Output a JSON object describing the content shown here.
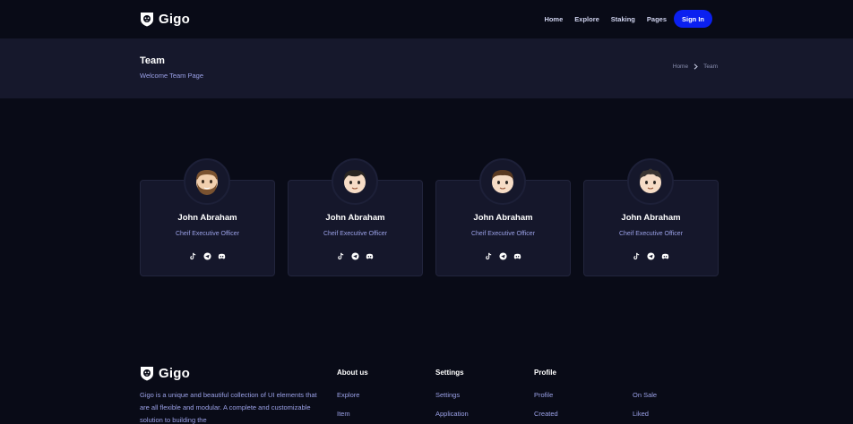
{
  "brand": {
    "name": "Gigo",
    "logo_icon": "lion-shield-icon"
  },
  "nav": {
    "items": [
      {
        "label": "Home"
      },
      {
        "label": "Explore"
      },
      {
        "label": "Staking"
      },
      {
        "label": "Pages"
      }
    ],
    "signin_label": "Sign In"
  },
  "banner": {
    "title": "Team",
    "subtitle": "Welcome Team Page",
    "breadcrumb": [
      "Home",
      "Team"
    ]
  },
  "team": {
    "members": [
      {
        "name": "John Abraham",
        "role": "Cheif Executive Officer",
        "avatar": "bearded-man-emoji",
        "socials": [
          "tiktok-icon",
          "telegram-icon",
          "discord-icon"
        ]
      },
      {
        "name": "John Abraham",
        "role": "Cheif Executive Officer",
        "avatar": "young-man-emoji",
        "socials": [
          "tiktok-icon",
          "telegram-icon",
          "discord-icon"
        ]
      },
      {
        "name": "John Abraham",
        "role": "Cheif Executive Officer",
        "avatar": "man-emoji",
        "socials": [
          "tiktok-icon",
          "telegram-icon",
          "discord-icon"
        ]
      },
      {
        "name": "John Abraham",
        "role": "Cheif Executive Officer",
        "avatar": "curly-man-emoji",
        "socials": [
          "tiktok-icon",
          "telegram-icon",
          "discord-icon"
        ]
      }
    ]
  },
  "footer": {
    "brand_name": "Gigo",
    "description": "Gigo is a unique and beautiful collection of UI elements that are all flexible and modular. A complete and customizable solution to building the",
    "columns": [
      {
        "title": "About us",
        "links": [
          "Explore",
          "Item"
        ]
      },
      {
        "title": "Settings",
        "links": [
          "Settings",
          "Application"
        ]
      },
      {
        "title": "Profile",
        "links": [
          "Profile",
          "Created"
        ]
      },
      {
        "title": "",
        "links": [
          "On Sale",
          "Liked"
        ]
      }
    ]
  },
  "colors": {
    "background": "#090b17",
    "surface": "#15172b",
    "accent": "#0b20f0",
    "muted_text": "#9aa0e6"
  }
}
